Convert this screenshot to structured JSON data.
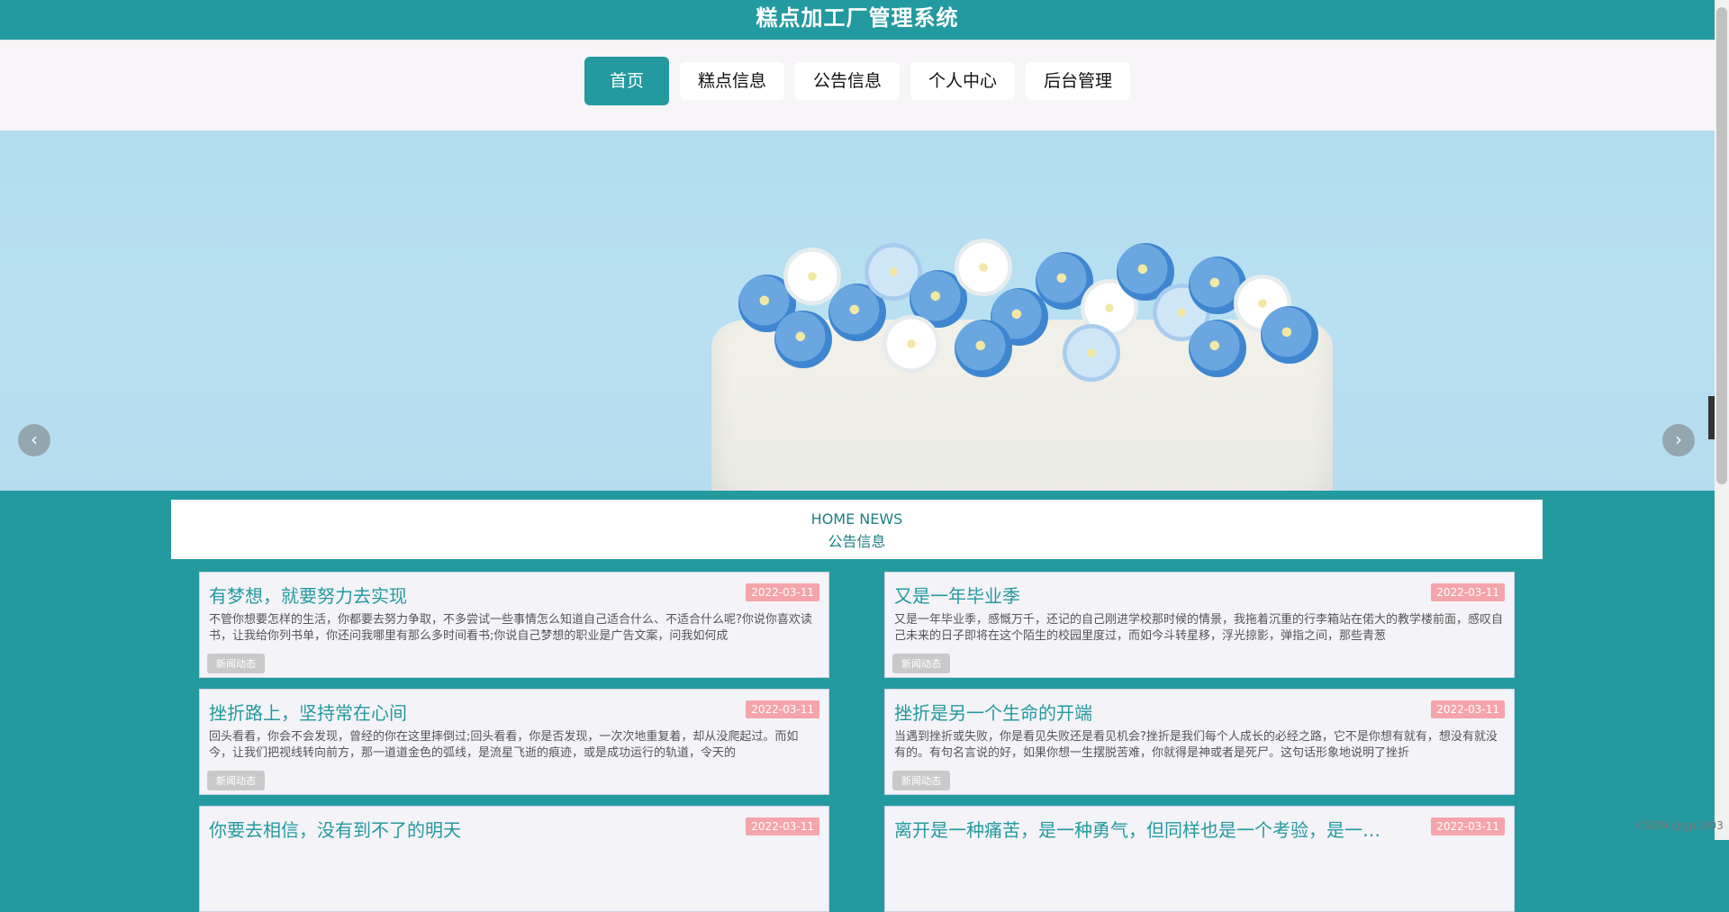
{
  "header": {
    "title": "糕点加工厂管理系统"
  },
  "nav": {
    "items": [
      "首页",
      "糕点信息",
      "公告信息",
      "个人中心",
      "后台管理"
    ],
    "active_index": 0
  },
  "banner": {
    "prev_icon": "chevron-left-icon",
    "next_icon": "chevron-right-icon",
    "pages": 3,
    "active_page": 1
  },
  "news": {
    "title_en": "HOME NEWS",
    "title_cn": "公告信息",
    "tag_label": "新闻动态",
    "items": [
      {
        "title": "有梦想，就要努力去实现",
        "date": "2022-03-11",
        "desc": "不管你想要怎样的生活，你都要去努力争取，不多尝试一些事情怎么知道自己适合什么、不适合什么呢?你说你喜欢读书，让我给你列书单，你还问我哪里有那么多时间看书;你说自己梦想的职业是广告文案，问我如何成"
      },
      {
        "title": "又是一年毕业季",
        "date": "2022-03-11",
        "desc": "又是一年毕业季，感慨万千，还记的自己刚进学校那时候的情景，我拖着沉重的行李箱站在偌大的教学楼前面，感叹自己未来的日子即将在这个陌生的校园里度过，而如今斗转星移，浮光掠影，弹指之间，那些青葱"
      },
      {
        "title": "挫折路上，坚持常在心间",
        "date": "2022-03-11",
        "desc": "回头看看，你会不会发现，曾经的你在这里摔倒过;回头看看，你是否发现，一次次地重复着，却从没爬起过。而如今，让我们把视线转向前方，那一道道金色的弧线，是流星飞逝的痕迹，或是成功运行的轨道，令天的"
      },
      {
        "title": "挫折是另一个生命的开端",
        "date": "2022-03-11",
        "desc": "当遇到挫折或失败，你是看见失败还是看见机会?挫折是我们每个人成长的必经之路，它不是你想有就有，想没有就没有的。有句名言说的好，如果你想一生摆脱苦难，你就得是神或者是死尸。这句话形象地说明了挫折"
      },
      {
        "title": "你要去相信，没有到不了的明天",
        "date": "2022-03-11",
        "desc": ""
      },
      {
        "title": "离开是一种痛苦，是一种勇气，但同样也是一个考验，是一个新的开始",
        "date": "2022-03-11",
        "desc": ""
      }
    ]
  },
  "watermark": "CSDN @gp1803"
}
